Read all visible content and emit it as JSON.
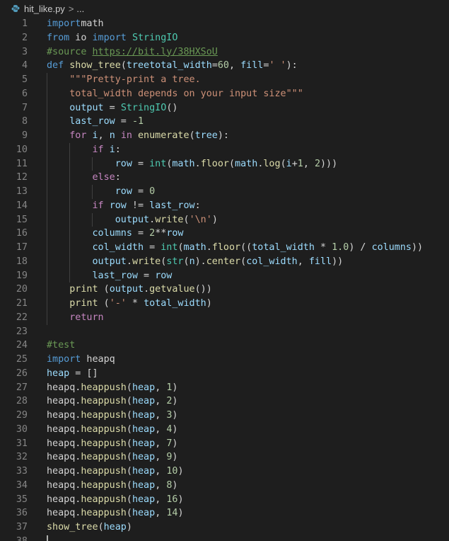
{
  "breadcrumb": {
    "icon": "python-file-icon",
    "filename": "hit_like.py",
    "separator": ">",
    "ellipsis": "..."
  },
  "editor": {
    "lines": [
      {
        "n": "1",
        "t": [
          [
            "kw",
            "import"
          ],
          [
            "",
            "math"
          ]
        ]
      },
      {
        "n": "2",
        "t": [
          [
            "kw",
            "from"
          ],
          [
            "",
            " io "
          ],
          [
            "kw",
            "import"
          ],
          [
            "",
            " "
          ],
          [
            "cls",
            "StringIO"
          ]
        ]
      },
      {
        "n": "3",
        "t": [
          [
            "cmt",
            "#source "
          ],
          [
            "url",
            "https://bit.ly/38HXSoU"
          ]
        ]
      },
      {
        "n": "4",
        "t": [
          [
            "kw",
            "def"
          ],
          [
            "",
            " "
          ],
          [
            "fn",
            "show_tree"
          ],
          [
            "",
            "("
          ],
          [
            "var",
            "tree"
          ],
          [
            ", "
          ],
          [
            "var",
            "total_width"
          ],
          [
            "",
            "="
          ],
          [
            "num",
            "60"
          ],
          [
            "",
            ", "
          ],
          [
            "var",
            "fill"
          ],
          [
            "",
            "="
          ],
          [
            "str",
            "' '"
          ],
          [
            "",
            "):"
          ]
        ]
      },
      {
        "n": "5",
        "t": [
          [
            "",
            "    "
          ],
          [
            "str",
            "\"\"\"Pretty-print a tree."
          ]
        ]
      },
      {
        "n": "6",
        "t": [
          [
            "",
            "    "
          ],
          [
            "str",
            "total_width depends on your input size\"\"\""
          ]
        ]
      },
      {
        "n": "7",
        "t": [
          [
            "",
            "    "
          ],
          [
            "var",
            "output"
          ],
          [
            "",
            " = "
          ],
          [
            "cls",
            "StringIO"
          ],
          [
            "",
            "()"
          ]
        ]
      },
      {
        "n": "8",
        "t": [
          [
            "",
            "    "
          ],
          [
            "var",
            "last_row"
          ],
          [
            "",
            " = "
          ],
          [
            "num",
            "-1"
          ]
        ]
      },
      {
        "n": "9",
        "t": [
          [
            "",
            "    "
          ],
          [
            "ctl",
            "for"
          ],
          [
            "",
            " "
          ],
          [
            "var",
            "i"
          ],
          [
            "",
            ", "
          ],
          [
            "var",
            "n"
          ],
          [
            "",
            " "
          ],
          [
            "ctl",
            "in"
          ],
          [
            "",
            " "
          ],
          [
            "fn",
            "enumerate"
          ],
          [
            "",
            "("
          ],
          [
            "var",
            "tree"
          ],
          [
            "",
            "):"
          ]
        ]
      },
      {
        "n": "10",
        "t": [
          [
            "",
            "        "
          ],
          [
            "ctl",
            "if"
          ],
          [
            "",
            " "
          ],
          [
            "var",
            "i"
          ],
          [
            "",
            ":"
          ]
        ]
      },
      {
        "n": "11",
        "t": [
          [
            "",
            "            "
          ],
          [
            "var",
            "row"
          ],
          [
            "",
            " = "
          ],
          [
            "cls",
            "int"
          ],
          [
            "",
            "("
          ],
          [
            "var",
            "math"
          ],
          [
            "",
            "."
          ],
          [
            "fn",
            "floor"
          ],
          [
            "",
            "("
          ],
          [
            "var",
            "math"
          ],
          [
            "",
            "."
          ],
          [
            "fn",
            "log"
          ],
          [
            "",
            "("
          ],
          [
            "var",
            "i"
          ],
          [
            "",
            "+"
          ],
          [
            "num",
            "1"
          ],
          [
            "",
            ", "
          ],
          [
            "num",
            "2"
          ],
          [
            "",
            ")))"
          ]
        ]
      },
      {
        "n": "12",
        "t": [
          [
            "",
            "        "
          ],
          [
            "ctl",
            "else"
          ],
          [
            "",
            ":"
          ]
        ]
      },
      {
        "n": "13",
        "t": [
          [
            "",
            "            "
          ],
          [
            "var",
            "row"
          ],
          [
            "",
            " = "
          ],
          [
            "num",
            "0"
          ]
        ]
      },
      {
        "n": "14",
        "t": [
          [
            "",
            "        "
          ],
          [
            "ctl",
            "if"
          ],
          [
            "",
            " "
          ],
          [
            "var",
            "row"
          ],
          [
            "",
            " != "
          ],
          [
            "var",
            "last_row"
          ],
          [
            "",
            ":"
          ]
        ]
      },
      {
        "n": "15",
        "t": [
          [
            "",
            "            "
          ],
          [
            "var",
            "output"
          ],
          [
            "",
            "."
          ],
          [
            "fn",
            "write"
          ],
          [
            "",
            "("
          ],
          [
            "str",
            "'\\n'"
          ],
          [
            "",
            ")"
          ]
        ]
      },
      {
        "n": "16",
        "t": [
          [
            "",
            "        "
          ],
          [
            "var",
            "columns"
          ],
          [
            "",
            " = "
          ],
          [
            "num",
            "2"
          ],
          [
            "",
            "**"
          ],
          [
            "var",
            "row"
          ]
        ]
      },
      {
        "n": "17",
        "t": [
          [
            "",
            "        "
          ],
          [
            "var",
            "col_width"
          ],
          [
            "",
            " = "
          ],
          [
            "cls",
            "int"
          ],
          [
            "",
            "("
          ],
          [
            "var",
            "math"
          ],
          [
            "",
            "."
          ],
          [
            "fn",
            "floor"
          ],
          [
            "",
            "(("
          ],
          [
            "var",
            "total_width"
          ],
          [
            "",
            " * "
          ],
          [
            "num",
            "1.0"
          ],
          [
            "",
            ") / "
          ],
          [
            "var",
            "columns"
          ],
          [
            "",
            "))"
          ]
        ]
      },
      {
        "n": "18",
        "t": [
          [
            "",
            "        "
          ],
          [
            "var",
            "output"
          ],
          [
            "",
            "."
          ],
          [
            "fn",
            "write"
          ],
          [
            "",
            "("
          ],
          [
            "cls",
            "str"
          ],
          [
            "",
            "("
          ],
          [
            "var",
            "n"
          ],
          [
            "",
            ")."
          ],
          [
            "fn",
            "center"
          ],
          [
            "",
            "("
          ],
          [
            "var",
            "col_width"
          ],
          [
            "",
            ", "
          ],
          [
            "var",
            "fill"
          ],
          [
            "",
            "))"
          ]
        ]
      },
      {
        "n": "19",
        "t": [
          [
            "",
            "        "
          ],
          [
            "var",
            "last_row"
          ],
          [
            "",
            " = "
          ],
          [
            "var",
            "row"
          ]
        ]
      },
      {
        "n": "20",
        "t": [
          [
            "",
            "    "
          ],
          [
            "fn",
            "print"
          ],
          [
            "",
            " ("
          ],
          [
            "var",
            "output"
          ],
          [
            "",
            "."
          ],
          [
            "fn",
            "getvalue"
          ],
          [
            "",
            "())"
          ]
        ]
      },
      {
        "n": "21",
        "t": [
          [
            "",
            "    "
          ],
          [
            "fn",
            "print"
          ],
          [
            "",
            " ("
          ],
          [
            "str",
            "'-'"
          ],
          [
            "",
            " * "
          ],
          [
            "var",
            "total_width"
          ],
          [
            "",
            ")"
          ]
        ]
      },
      {
        "n": "22",
        "t": [
          [
            "",
            "    "
          ],
          [
            "ctl",
            "return"
          ]
        ]
      },
      {
        "n": "23",
        "t": []
      },
      {
        "n": "24",
        "t": [
          [
            "cmt",
            "#test"
          ]
        ]
      },
      {
        "n": "25",
        "t": [
          [
            "kw",
            "import"
          ],
          [
            "",
            " heapq"
          ]
        ]
      },
      {
        "n": "26",
        "t": [
          [
            "var",
            "heap"
          ],
          [
            "",
            " = []"
          ]
        ]
      },
      {
        "n": "27",
        "t": [
          [
            "",
            "heapq."
          ],
          [
            "fn",
            "heappush"
          ],
          [
            "",
            "("
          ],
          [
            "var",
            "heap"
          ],
          [
            "",
            ", "
          ],
          [
            "num",
            "1"
          ],
          [
            "",
            ")"
          ]
        ]
      },
      {
        "n": "28",
        "t": [
          [
            "",
            "heapq."
          ],
          [
            "fn",
            "heappush"
          ],
          [
            "",
            "("
          ],
          [
            "var",
            "heap"
          ],
          [
            "",
            ", "
          ],
          [
            "num",
            "2"
          ],
          [
            "",
            ")"
          ]
        ]
      },
      {
        "n": "29",
        "t": [
          [
            "",
            "heapq."
          ],
          [
            "fn",
            "heappush"
          ],
          [
            "",
            "("
          ],
          [
            "var",
            "heap"
          ],
          [
            "",
            ", "
          ],
          [
            "num",
            "3"
          ],
          [
            "",
            ")"
          ]
        ]
      },
      {
        "n": "30",
        "t": [
          [
            "",
            "heapq."
          ],
          [
            "fn",
            "heappush"
          ],
          [
            "",
            "("
          ],
          [
            "var",
            "heap"
          ],
          [
            "",
            ", "
          ],
          [
            "num",
            "4"
          ],
          [
            "",
            ")"
          ]
        ]
      },
      {
        "n": "31",
        "t": [
          [
            "",
            "heapq."
          ],
          [
            "fn",
            "heappush"
          ],
          [
            "",
            "("
          ],
          [
            "var",
            "heap"
          ],
          [
            "",
            ", "
          ],
          [
            "num",
            "7"
          ],
          [
            "",
            ")"
          ]
        ]
      },
      {
        "n": "32",
        "t": [
          [
            "",
            "heapq."
          ],
          [
            "fn",
            "heappush"
          ],
          [
            "",
            "("
          ],
          [
            "var",
            "heap"
          ],
          [
            "",
            ", "
          ],
          [
            "num",
            "9"
          ],
          [
            "",
            ")"
          ]
        ]
      },
      {
        "n": "33",
        "t": [
          [
            "",
            "heapq."
          ],
          [
            "fn",
            "heappush"
          ],
          [
            "",
            "("
          ],
          [
            "var",
            "heap"
          ],
          [
            "",
            ", "
          ],
          [
            "num",
            "10"
          ],
          [
            "",
            ")"
          ]
        ]
      },
      {
        "n": "34",
        "t": [
          [
            "",
            "heapq."
          ],
          [
            "fn",
            "heappush"
          ],
          [
            "",
            "("
          ],
          [
            "var",
            "heap"
          ],
          [
            "",
            ", "
          ],
          [
            "num",
            "8"
          ],
          [
            "",
            ")"
          ]
        ]
      },
      {
        "n": "35",
        "t": [
          [
            "",
            "heapq."
          ],
          [
            "fn",
            "heappush"
          ],
          [
            "",
            "("
          ],
          [
            "var",
            "heap"
          ],
          [
            "",
            ", "
          ],
          [
            "num",
            "16"
          ],
          [
            "",
            ")"
          ]
        ]
      },
      {
        "n": "36",
        "t": [
          [
            "",
            "heapq."
          ],
          [
            "fn",
            "heappush"
          ],
          [
            "",
            "("
          ],
          [
            "var",
            "heap"
          ],
          [
            "",
            ", "
          ],
          [
            "num",
            "14"
          ],
          [
            "",
            ")"
          ]
        ]
      },
      {
        "n": "37",
        "t": [
          [
            "fn",
            "show_tree"
          ],
          [
            "",
            "("
          ],
          [
            "var",
            "heap"
          ],
          [
            "",
            ")"
          ]
        ]
      },
      {
        "n": "38",
        "t": []
      }
    ]
  }
}
